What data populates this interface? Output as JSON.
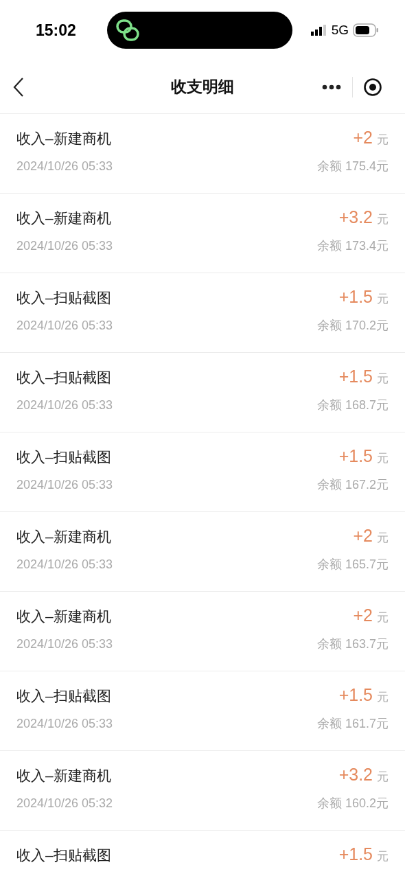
{
  "status_bar": {
    "time": "15:02",
    "network": "5G"
  },
  "nav_bar": {
    "title": "收支明细"
  },
  "records": [
    {
      "title": "收入–新建商机",
      "amount": "+2",
      "unit": "元",
      "time": "2024/10/26 05:33",
      "balance": "余额 175.4元"
    },
    {
      "title": "收入–新建商机",
      "amount": "+3.2",
      "unit": "元",
      "time": "2024/10/26 05:33",
      "balance": "余额 173.4元"
    },
    {
      "title": "收入–扫贴截图",
      "amount": "+1.5",
      "unit": "元",
      "time": "2024/10/26 05:33",
      "balance": "余额 170.2元"
    },
    {
      "title": "收入–扫贴截图",
      "amount": "+1.5",
      "unit": "元",
      "time": "2024/10/26 05:33",
      "balance": "余额 168.7元"
    },
    {
      "title": "收入–扫贴截图",
      "amount": "+1.5",
      "unit": "元",
      "time": "2024/10/26 05:33",
      "balance": "余额 167.2元"
    },
    {
      "title": "收入–新建商机",
      "amount": "+2",
      "unit": "元",
      "time": "2024/10/26 05:33",
      "balance": "余额 165.7元"
    },
    {
      "title": "收入–新建商机",
      "amount": "+2",
      "unit": "元",
      "time": "2024/10/26 05:33",
      "balance": "余额 163.7元"
    },
    {
      "title": "收入–扫贴截图",
      "amount": "+1.5",
      "unit": "元",
      "time": "2024/10/26 05:33",
      "balance": "余额 161.7元"
    },
    {
      "title": "收入–新建商机",
      "amount": "+3.2",
      "unit": "元",
      "time": "2024/10/26 05:32",
      "balance": "余额 160.2元"
    },
    {
      "title": "收入–扫贴截图",
      "amount": "+1.5",
      "unit": "元"
    }
  ]
}
